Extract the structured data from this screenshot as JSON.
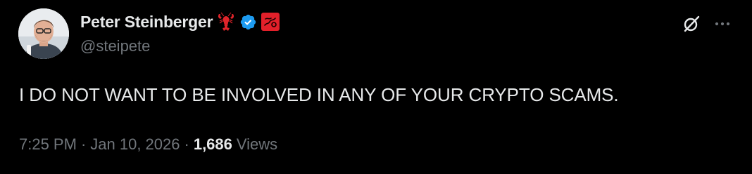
{
  "author": {
    "display_name": "Peter Steinberger",
    "handle": "@steipete",
    "emoji_badge": "🦞"
  },
  "tweet": {
    "text": "I DO NOT WANT TO BE INVOLVED IN ANY OF YOUR CRYPTO SCAMS."
  },
  "meta": {
    "time": "7:25 PM",
    "date": "Jan 10, 2026",
    "separator": "·",
    "view_count": "1,686",
    "views_label": "Views"
  },
  "icons": {
    "verified": "verified-badge-icon",
    "affiliate": "affiliate-badge-icon",
    "grok": "grok-icon",
    "more": "more-icon"
  },
  "colors": {
    "background": "#000000",
    "text_primary": "#e7e9ea",
    "text_secondary": "#71767b",
    "verified_blue": "#1d9bf0",
    "lobster_red": "#e0242a",
    "affiliate_red": "#e3202a"
  }
}
